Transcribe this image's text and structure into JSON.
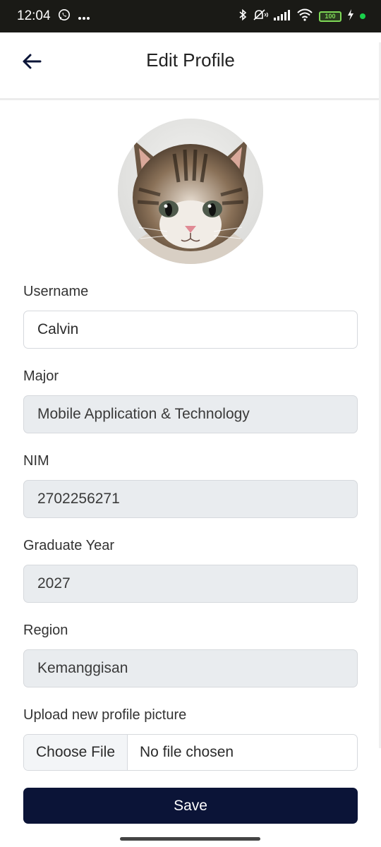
{
  "status_bar": {
    "time": "12:04",
    "battery": "100",
    "left_icons": [
      "whatsapp-icon",
      "more-icon"
    ],
    "right_icons": [
      "bluetooth-icon",
      "mute-vibrate-icon",
      "signal-icon",
      "wifi-icon",
      "battery-icon",
      "charging-icon"
    ]
  },
  "header": {
    "title": "Edit Profile",
    "back_icon": "arrow-left-icon"
  },
  "profile": {
    "avatar_icon": "cat-avatar"
  },
  "form": {
    "username": {
      "label": "Username",
      "value": "Calvin"
    },
    "major": {
      "label": "Major",
      "value": "Mobile Application & Technology"
    },
    "nim": {
      "label": "NIM",
      "value": "2702256271"
    },
    "graduate_year": {
      "label": "Graduate Year",
      "value": "2027"
    },
    "region": {
      "label": "Region",
      "value": "Kemanggisan"
    },
    "upload": {
      "label": "Upload new profile picture",
      "button_label": "Choose File",
      "status": "No file chosen"
    }
  },
  "actions": {
    "save_label": "Save"
  },
  "colors": {
    "primary": "#0b1437",
    "readonly_bg": "#e9ecef",
    "status_bar_bg": "#1a1a16"
  }
}
